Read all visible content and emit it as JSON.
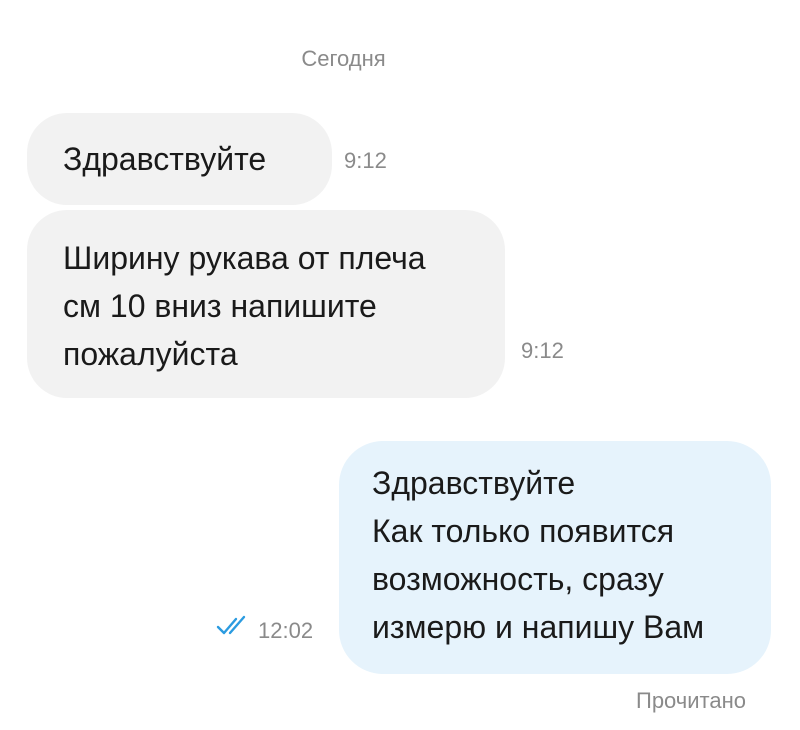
{
  "chat": {
    "date_separator": "Сегодня",
    "messages": [
      {
        "direction": "incoming",
        "text": "Здравствуйте",
        "time": "9:12"
      },
      {
        "direction": "incoming",
        "text": "Ширину рукава от плеча\nсм 10 вниз напишите\nпожалуйста",
        "time": "9:12"
      },
      {
        "direction": "outgoing",
        "text": "Здравствуйте\nКак только появится\nвозможность, сразу\nизмерю и напишу Вам",
        "time": "12:02",
        "status_icon": "double-check-icon"
      }
    ],
    "read_status": "Прочитано"
  },
  "colors": {
    "incoming_bubble": "#f2f2f2",
    "outgoing_bubble": "#e6f3fc",
    "check_color": "#2b9be0",
    "meta_text": "#8a8a8a"
  }
}
